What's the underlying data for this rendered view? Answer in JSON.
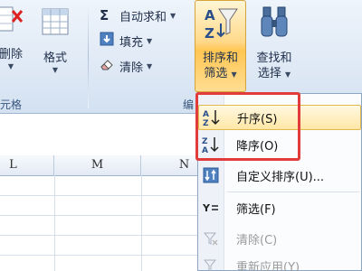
{
  "ribbon": {
    "delete_label": "删除",
    "format_label": "格式",
    "cells_group_label": "元格",
    "autosum_label": "自动求和",
    "fill_label": "填充",
    "clear_label": "清除",
    "sort_filter_line1": "排序和",
    "sort_filter_line2": "筛选",
    "find_select_line1": "查找和",
    "find_select_line2": "选择",
    "editing_group_label": "编"
  },
  "columns": [
    "L",
    "M",
    "N"
  ],
  "menu": {
    "items": [
      {
        "label": "升序(S)",
        "icon": "sort-ascending-icon",
        "enabled": true
      },
      {
        "label": "降序(O)",
        "icon": "sort-descending-icon",
        "enabled": true
      },
      {
        "label": "自定义排序(U)...",
        "icon": "custom-sort-icon",
        "enabled": true
      },
      {
        "label": "筛选(F)",
        "icon": "filter-icon",
        "enabled": true
      },
      {
        "label": "清除(C)",
        "icon": "clear-filter-icon",
        "enabled": false
      },
      {
        "label": "重新应用(Y)",
        "icon": "reapply-icon",
        "enabled": false
      }
    ]
  },
  "colors": {
    "highlight_border": "#e13b3b",
    "active_button": "#ffc653"
  }
}
